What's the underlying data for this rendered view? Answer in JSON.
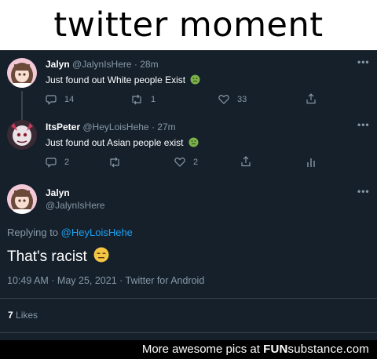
{
  "caption": "twitter moment",
  "tweets": [
    {
      "name": "Jalyn",
      "handle": "@JalynIsHere",
      "time": "· 28m",
      "text": "Just found out White people Exist",
      "replies": "14",
      "retweets": "1",
      "likes": "33"
    },
    {
      "name": "ItsPeter",
      "handle": "@HeyLoisHehe",
      "time": "· 27m",
      "text": "Just found out Asian people exist",
      "replies": "2",
      "retweets": "",
      "likes": "2"
    }
  ],
  "main_tweet": {
    "name": "Jalyn",
    "handle": "@JalynIsHere",
    "replying_prefix": "Replying to",
    "replying_to": "@HeyLoisHehe",
    "text": "That's racist",
    "meta": "10:49 AM · May 25, 2021 · Twitter for Android",
    "likes_count": "7",
    "likes_label": "Likes"
  },
  "footer": {
    "prefix": "More awesome pics at",
    "brand_bold": "FUN",
    "brand_rest": "substance.com"
  },
  "colors": {
    "background": "#15202b",
    "muted": "#8899a6",
    "link": "#1da1f2",
    "divider": "#38444d"
  },
  "icons": [
    "more-icon",
    "reply-icon",
    "retweet-icon",
    "like-icon",
    "share-icon",
    "analytics-icon",
    "nauseated-face-icon",
    "expressionless-face-icon"
  ]
}
